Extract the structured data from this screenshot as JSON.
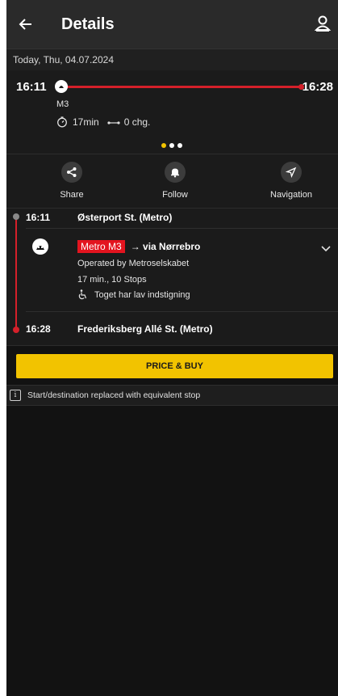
{
  "header": {
    "title": "Details",
    "back_icon": "arrow-left-icon",
    "profile_icon": "user-location-icon"
  },
  "date_bar": {
    "text": "Today, Thu, 04.07.2024"
  },
  "summary": {
    "departure_time": "16:11",
    "arrival_time": "16:28",
    "line": "M3",
    "duration": "17min",
    "changes": "0 chg.",
    "pager_pages": 3,
    "pager_active_index": 0
  },
  "actions": [
    {
      "label": "Share",
      "icon": "share-icon"
    },
    {
      "label": "Follow",
      "icon": "bell-icon"
    },
    {
      "label": "Navigation",
      "icon": "navigation-icon"
    }
  ],
  "itinerary": {
    "from": {
      "time": "16:11",
      "name": "Østerport St. (Metro)"
    },
    "leg": {
      "badge": "Metro M3",
      "direction": "→ via Nørrebro",
      "operator": "Operated by Metroselskabet",
      "stops": "17 min., 10 Stops",
      "accessibility": "Toget har lav indstigning"
    },
    "to": {
      "time": "16:28",
      "name": "Frederiksberg Allé St. (Metro)"
    }
  },
  "buy": {
    "label": "PRICE & BUY"
  },
  "notice": {
    "text": "Start/destination replaced with equivalent stop"
  },
  "colors": {
    "accent": "#f2c300",
    "metro_red": "#d4202a",
    "background": "#121212"
  }
}
